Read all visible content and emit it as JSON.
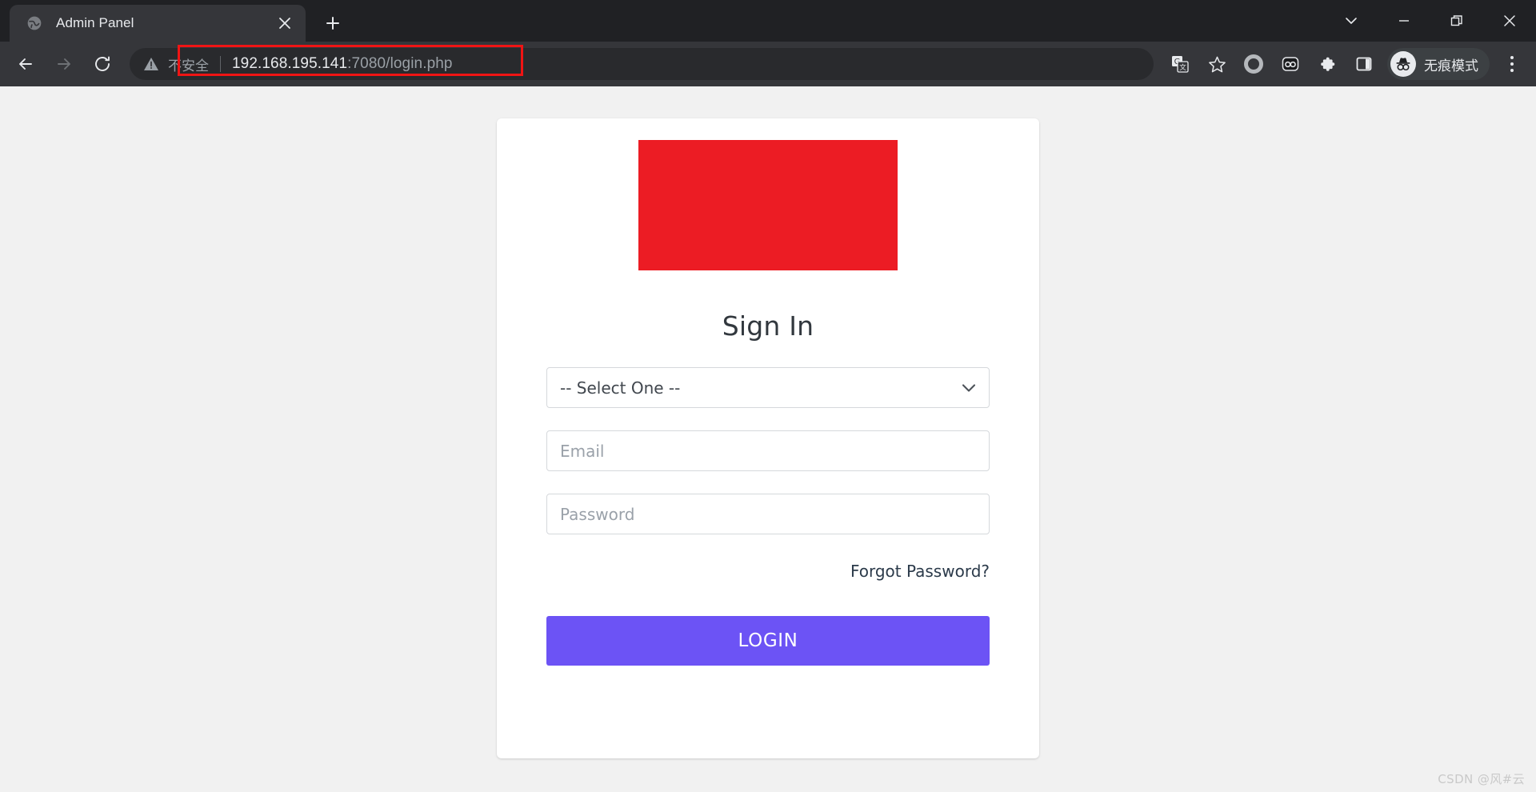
{
  "browser": {
    "tab": {
      "title": "Admin Panel",
      "favicon_icon": "globe-icon",
      "close_icon": "close-icon"
    },
    "new_tab_icon": "plus-icon",
    "window_controls": [
      {
        "name": "tab-search",
        "icon": "chevron-down-icon"
      },
      {
        "name": "minimize",
        "icon": "minimize-icon"
      },
      {
        "name": "maximize",
        "icon": "restore-icon"
      },
      {
        "name": "close",
        "icon": "close-icon"
      }
    ],
    "nav": {
      "back_icon": "arrow-left-icon",
      "forward_icon": "arrow-right-icon",
      "reload_icon": "reload-icon"
    },
    "omnibox": {
      "security_icon": "warning-triangle-icon",
      "security_label": "不安全",
      "url_host": "192.168.195.141",
      "url_rest": ":7080/login.php",
      "full_url": "192.168.195.141:7080/login.php"
    },
    "annotation": {
      "color": "#f01414",
      "shape": "rectangle"
    },
    "toolbar_icons": [
      {
        "name": "translate-icon",
        "label": "G"
      },
      {
        "name": "bookmark-star-icon",
        "label": ""
      },
      {
        "name": "profile-circle-icon",
        "label": ""
      },
      {
        "name": "password-manager-icon",
        "label": ""
      },
      {
        "name": "extensions-puzzle-icon",
        "label": ""
      },
      {
        "name": "side-panel-icon",
        "label": ""
      }
    ],
    "profile_chip": {
      "label": "无痕模式",
      "icon": "incognito-icon"
    },
    "menu_icon": "three-dot-menu-icon"
  },
  "page": {
    "background_color": "#f1f1f1",
    "card": {
      "logo": {
        "name": "broken-logo-image",
        "color": "#ec1c24"
      },
      "heading": "Sign In",
      "select": {
        "value": "-- Select One --",
        "chevron_icon": "chevron-down-icon"
      },
      "email": {
        "placeholder": "Email",
        "value": ""
      },
      "password": {
        "placeholder": "Password",
        "value": ""
      },
      "forgot_password": "Forgot Password?",
      "login_button": {
        "label": "LOGIN",
        "color": "#6c53f5"
      }
    },
    "watermark": "CSDN @风#云"
  }
}
